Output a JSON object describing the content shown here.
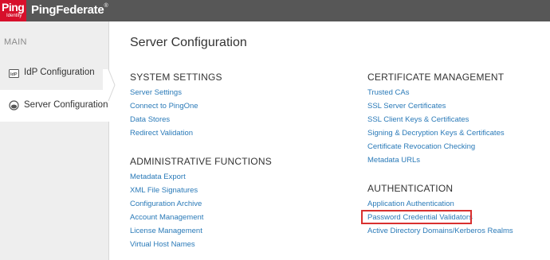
{
  "header": {
    "logo_text": "Ping",
    "logo_subtext": "Identity",
    "product_name": "PingFederate",
    "product_mark": "®"
  },
  "sidebar": {
    "section_label": "MAIN",
    "items": [
      {
        "label": "IdP Configuration",
        "icon": "idp-icon",
        "active": false
      },
      {
        "label": "Server Configuration",
        "icon": "server-config-icon",
        "active": true
      }
    ]
  },
  "main": {
    "title": "Server Configuration",
    "sections": {
      "system_settings": {
        "title": "SYSTEM SETTINGS",
        "links": [
          "Server Settings",
          "Connect to PingOne",
          "Data Stores",
          "Redirect Validation"
        ]
      },
      "administrative_functions": {
        "title": "ADMINISTRATIVE FUNCTIONS",
        "links": [
          "Metadata Export",
          "XML File Signatures",
          "Configuration Archive",
          "Account Management",
          "License Management",
          "Virtual Host Names"
        ]
      },
      "certificate_management": {
        "title": "CERTIFICATE MANAGEMENT",
        "links": [
          "Trusted CAs",
          "SSL Server Certificates",
          "SSL Client Keys & Certificates",
          "Signing & Decryption Keys & Certificates",
          "Certificate Revocation Checking",
          "Metadata URLs"
        ]
      },
      "authentication": {
        "title": "AUTHENTICATION",
        "links": [
          "Application Authentication",
          "Password Credential Validators",
          "Active Directory Domains/Kerberos Realms"
        ]
      }
    },
    "highlighted_link": "Password Credential Validators"
  },
  "colors": {
    "topbar": "#575757",
    "brand_red": "#d7102b",
    "link": "#2a7ab8",
    "highlight_border": "#d9302f",
    "sidebar_bg": "#eeeeee"
  }
}
